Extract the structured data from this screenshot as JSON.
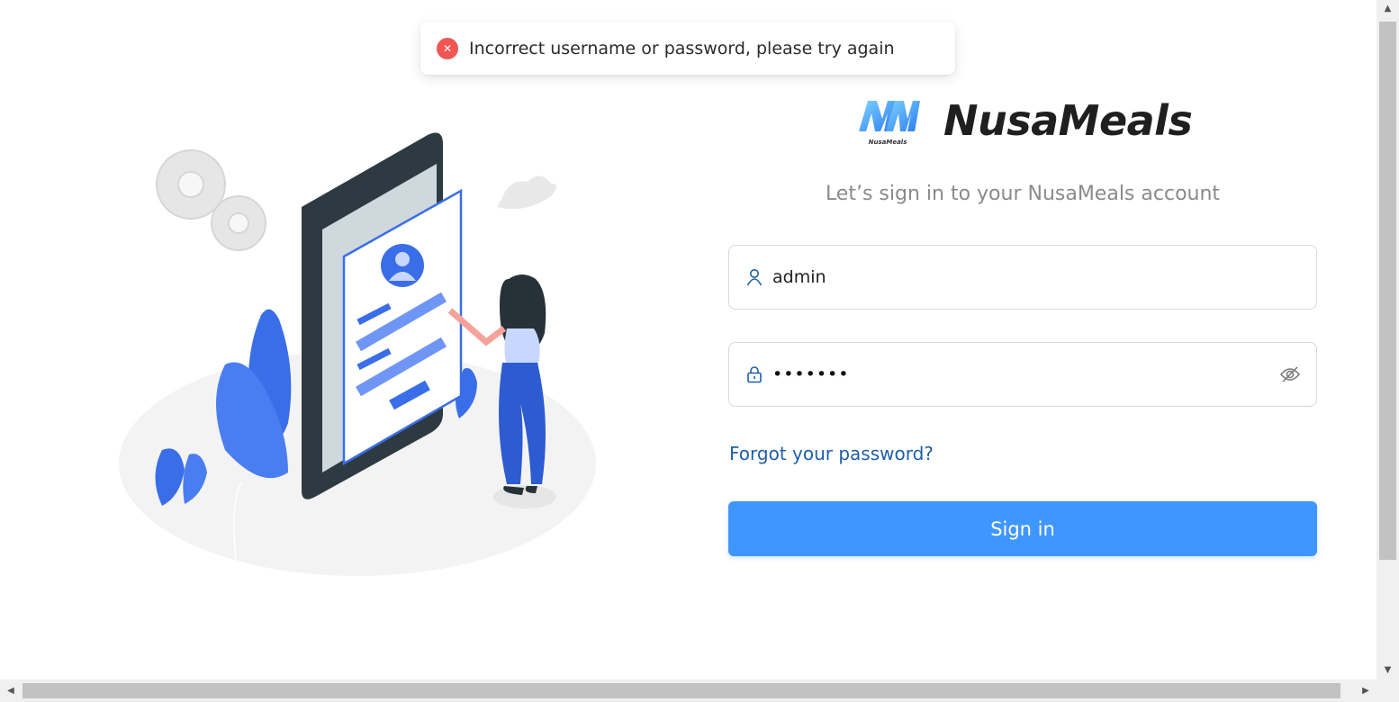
{
  "toast": {
    "icon": "close-circle-icon",
    "message": "Incorrect username or password, please try again",
    "color": "#f25555"
  },
  "brand": {
    "logo_text": "NusaMeals",
    "name": "NusaMeals"
  },
  "subtitle": "Let’s sign in to your NusaMeals account",
  "form": {
    "username": {
      "value": "admin",
      "icon": "user-icon"
    },
    "password": {
      "masked_value": "•••••••",
      "icon": "lock-icon",
      "toggle_icon": "eye-slash-icon"
    },
    "forgot_label": "Forgot your password?",
    "signin_label": "Sign in"
  },
  "colors": {
    "primary": "#4096ff",
    "link": "#1e5fa8",
    "illustration_blue": "#3a6ee8"
  }
}
